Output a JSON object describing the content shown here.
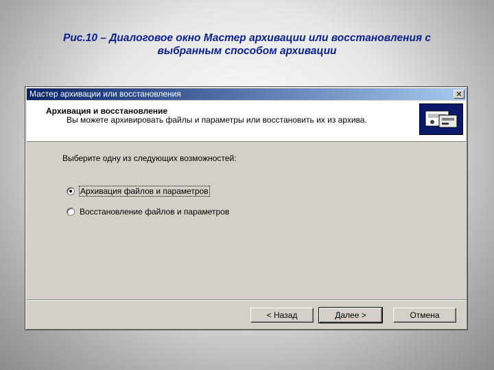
{
  "caption": {
    "line1": "Рис.10 – Диалоговое окно Мастер архивации или восстановления с",
    "line2": "выбранным способом архивации"
  },
  "dialog": {
    "title": "Мастер архивации или восстановления",
    "close_glyph": "✕",
    "header": {
      "title": "Архивация и восстановление",
      "description": "Вы можете архивировать файлы и параметры или восстановить их из архива.",
      "icon": "backup-wizard-icon"
    },
    "prompt": "Выберите одну из следующих возможностей:",
    "options": [
      {
        "label": "Архивация файлов и параметров",
        "checked": true
      },
      {
        "label": "Восстановление файлов и параметров",
        "checked": false
      }
    ],
    "buttons": {
      "back": "< Назад",
      "next": "Далее >",
      "cancel": "Отмена"
    }
  },
  "colors": {
    "caption_text": "#0a1f8f",
    "title_bar_start": "#0a246a",
    "title_bar_end": "#a6caf0",
    "dialog_face": "#d4d0c8"
  }
}
